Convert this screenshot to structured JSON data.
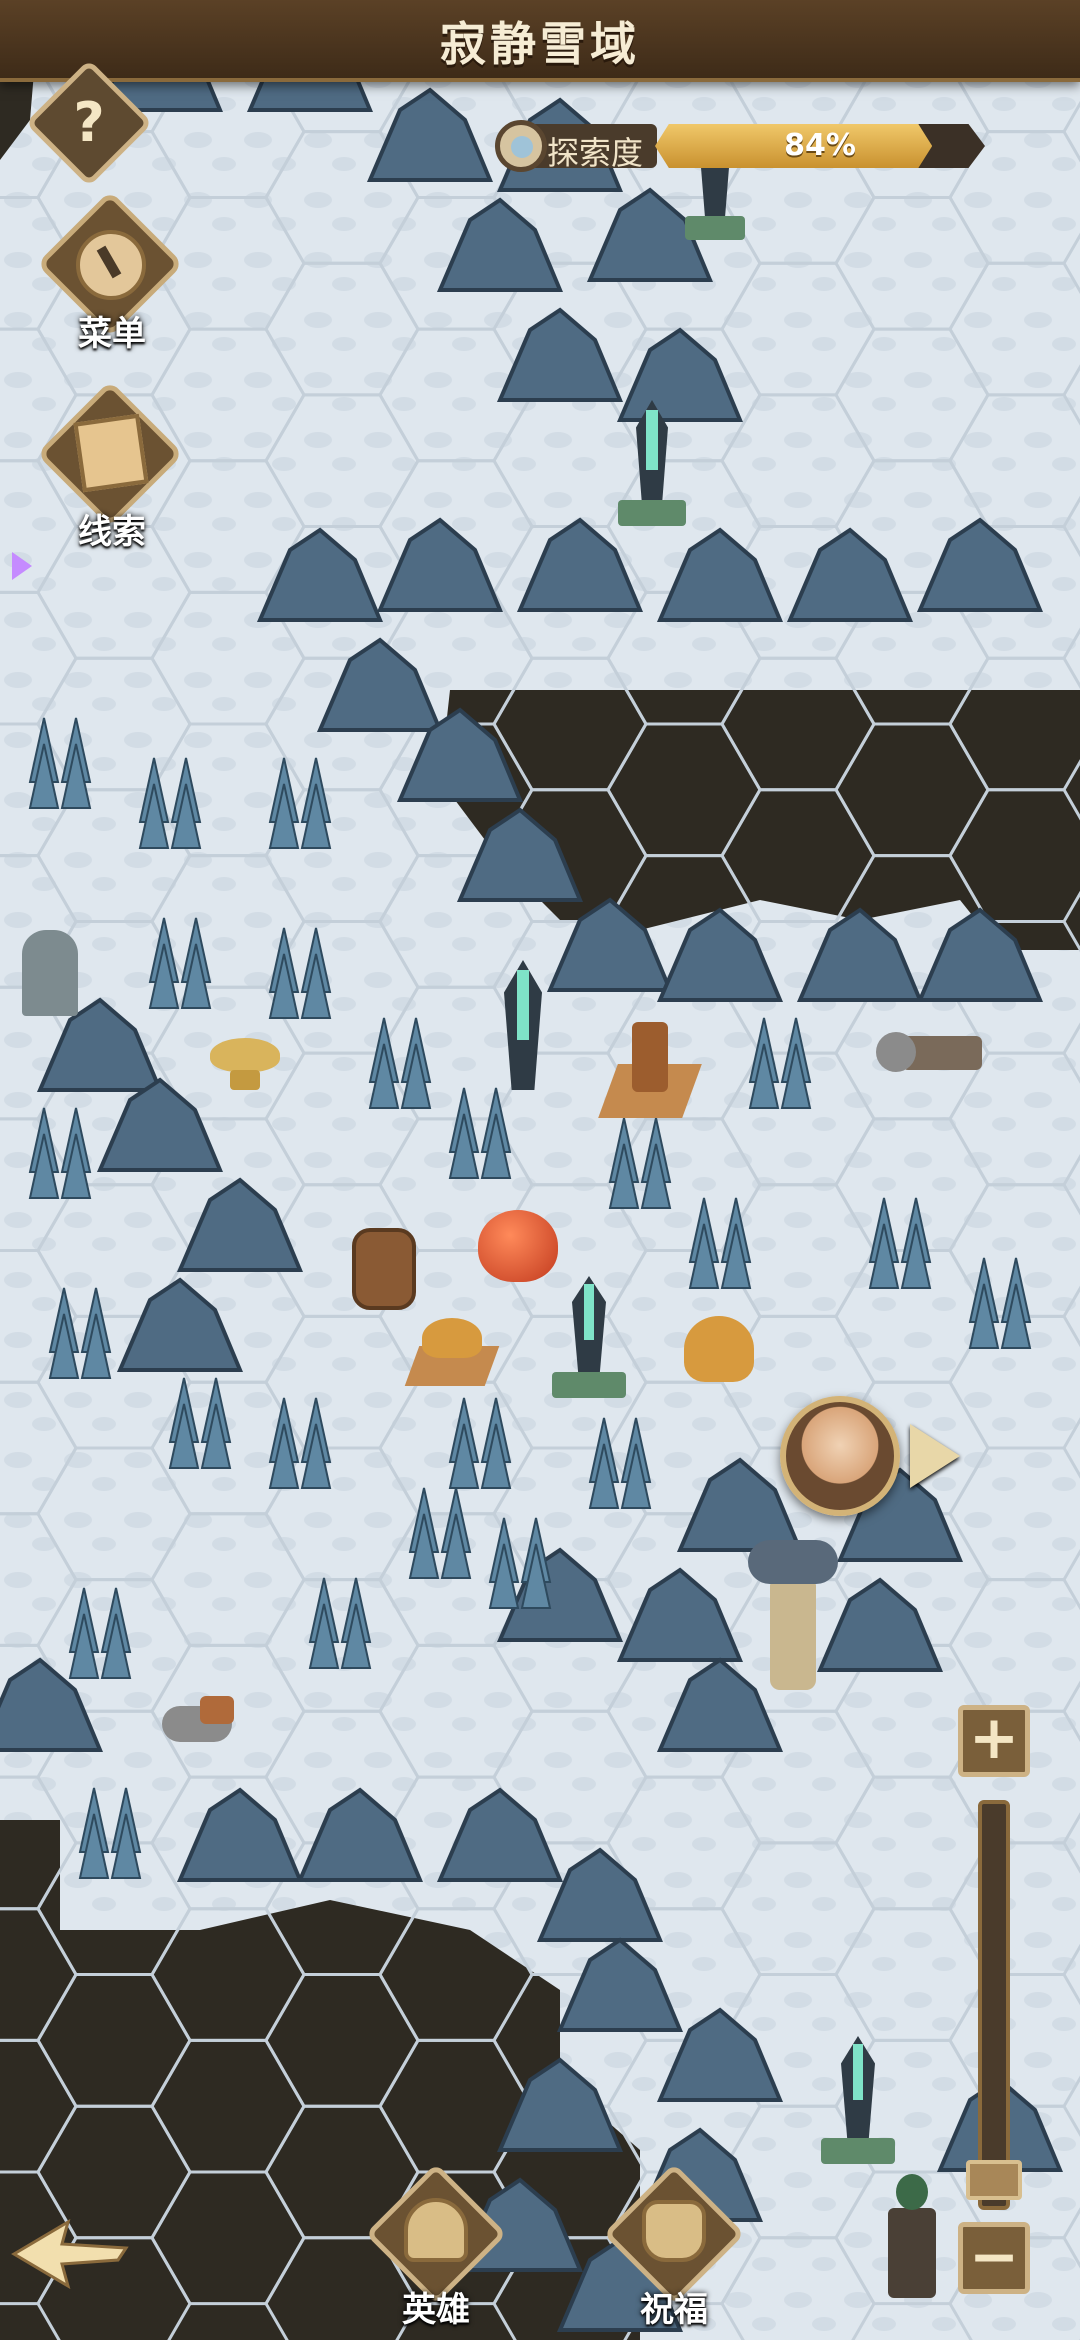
{
  "header": {
    "title": "寂静雪域"
  },
  "exploration": {
    "label": "探索度",
    "value_text": "84%",
    "progress": 0.84
  },
  "side_menu": {
    "menu_label": "菜单",
    "clue_label": "线索",
    "help_glyph": "?"
  },
  "zoom": {
    "in_label": "+",
    "out_label": "−"
  },
  "bottom_nav": {
    "hero_label": "英雄",
    "blessing_label": "祝福"
  },
  "colors": {
    "snow": "#dfe7ee",
    "ice_rock": "#4f6b83",
    "chasm": "#2e2a22",
    "ui_wood": "#5e4a30",
    "ui_gold": "#cdb285",
    "progress": "#e2b24f"
  },
  "icons": {
    "help": "question-icon",
    "menu": "stopwatch-icon",
    "clue": "book-icon",
    "back": "arrow-left-icon",
    "hero": "helmet-icon",
    "blessing": "bag-icon",
    "player": "hero-portrait",
    "move": "arrow-right-icon"
  }
}
